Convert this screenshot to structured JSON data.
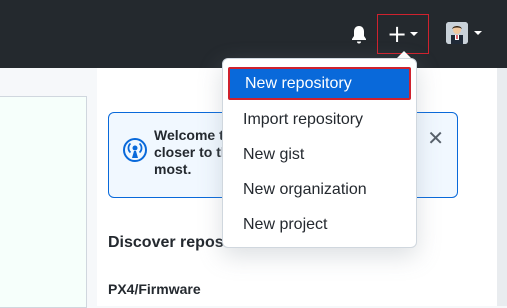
{
  "header": {
    "icons": [
      "bell-icon",
      "plus-icon",
      "avatar"
    ],
    "bg_color": "#24292e"
  },
  "dropdown": {
    "items": [
      {
        "label": "New repository",
        "highlighted": true
      },
      {
        "label": "Import repository"
      },
      {
        "label": "New gist"
      },
      {
        "label": "New organization"
      },
      {
        "label": "New project"
      }
    ],
    "highlight_color": "#0969da",
    "highlight_border": "#cf222e"
  },
  "welcome": {
    "lines": [
      "Welcome t",
      "closer to th",
      "most."
    ],
    "close_glyph": "✕"
  },
  "discover": {
    "heading": "Discover repositories",
    "repo": "PX4/Firmware"
  }
}
